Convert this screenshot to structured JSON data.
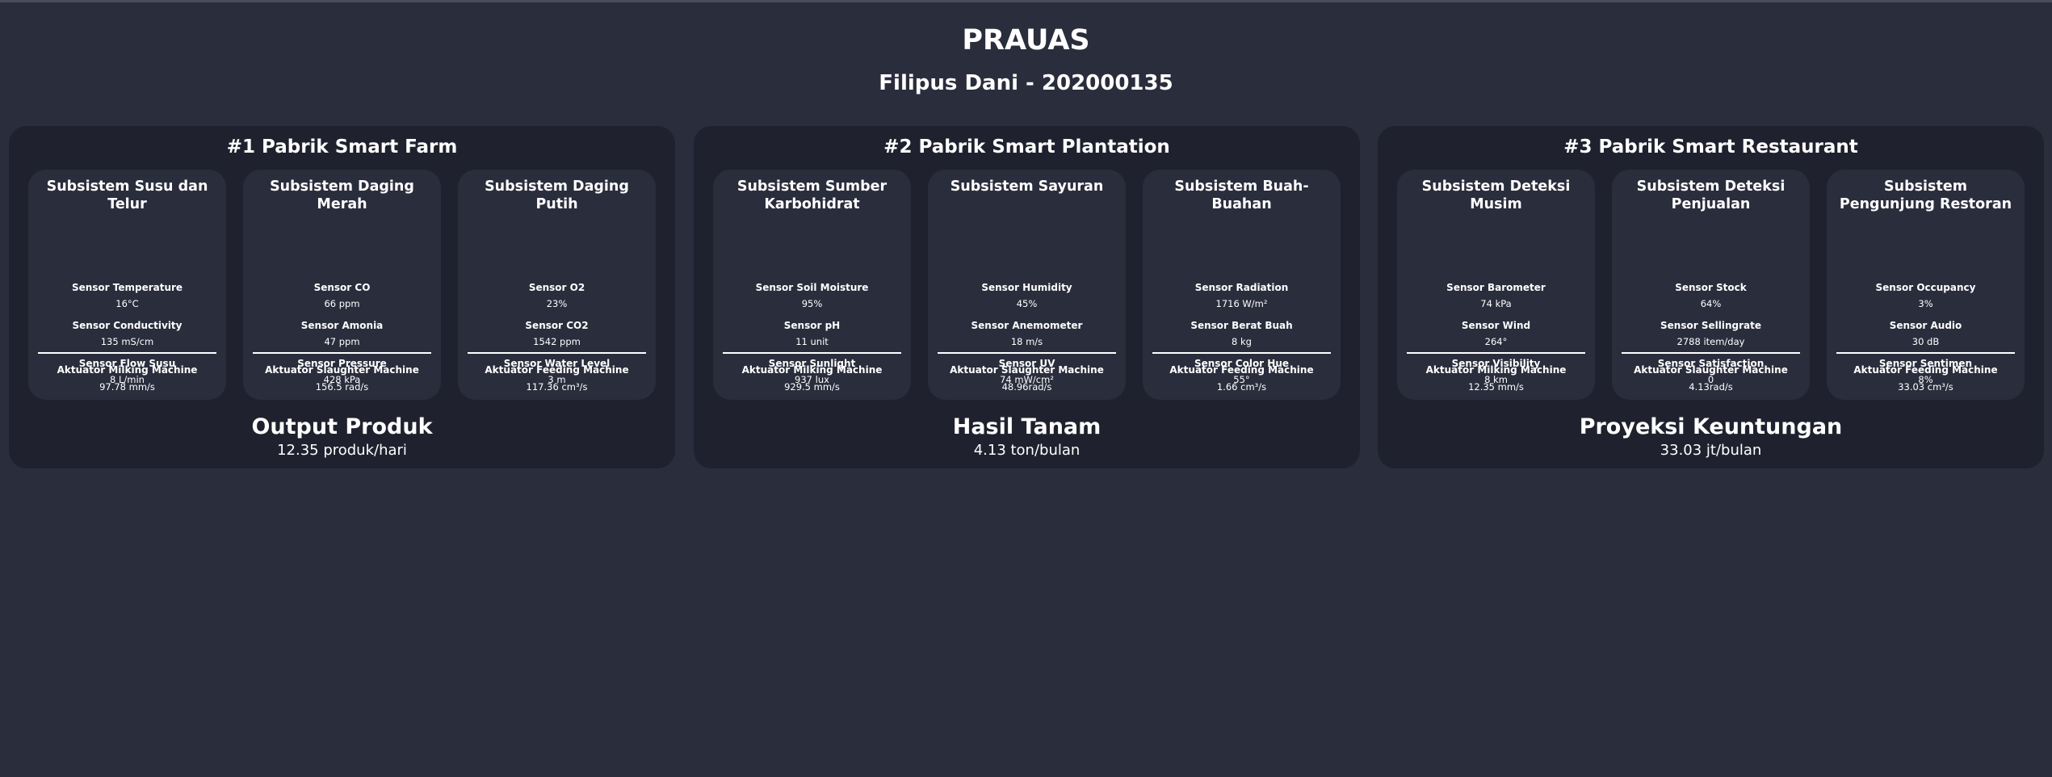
{
  "header": {
    "title": "PRAUAS",
    "subtitle": "Filipus Dani - 202000135"
  },
  "factories": [
    {
      "title": "#1 Pabrik Smart Farm",
      "output_title": "Output Produk",
      "output_value": "12.35 produk/hari",
      "subsystems": [
        {
          "title": "Subsistem Susu dan Telur",
          "sensors": [
            {
              "name": "Sensor Temperature",
              "value": "16°C"
            },
            {
              "name": "Sensor Conductivity",
              "value": "135 mS/cm"
            },
            {
              "name": "Sensor Flow Susu",
              "value": "8 L/min"
            }
          ],
          "actuator": {
            "name": "Aktuator Milking Machine",
            "value": "97.78 mm/s"
          }
        },
        {
          "title": "Subsistem Daging Merah",
          "sensors": [
            {
              "name": "Sensor CO",
              "value": "66 ppm"
            },
            {
              "name": "Sensor Amonia",
              "value": "47 ppm"
            },
            {
              "name": "Sensor Pressure",
              "value": "428 kPa"
            }
          ],
          "actuator": {
            "name": "Aktuator Slaughter Machine",
            "value": "156.5 rad/s"
          }
        },
        {
          "title": "Subsistem Daging Putih",
          "sensors": [
            {
              "name": "Sensor O2",
              "value": "23%"
            },
            {
              "name": "Sensor CO2",
              "value": "1542 ppm"
            },
            {
              "name": "Sensor Water Level",
              "value": "3 m"
            }
          ],
          "actuator": {
            "name": "Aktuator Feeding Machine",
            "value": "117.36 cm³/s"
          }
        }
      ]
    },
    {
      "title": "#2 Pabrik Smart Plantation",
      "output_title": "Hasil Tanam",
      "output_value": "4.13 ton/bulan",
      "subsystems": [
        {
          "title": "Subsistem Sumber Karbohidrat",
          "sensors": [
            {
              "name": "Sensor Soil Moisture",
              "value": "95%"
            },
            {
              "name": "Sensor pH",
              "value": "11 unit"
            },
            {
              "name": "Sensor Sunlight",
              "value": "937 lux"
            }
          ],
          "actuator": {
            "name": "Aktuator Milking Machine",
            "value": "929.5 mm/s"
          }
        },
        {
          "title": "Subsistem Sayuran",
          "sensors": [
            {
              "name": "Sensor Humidity",
              "value": "45%"
            },
            {
              "name": "Sensor Anemometer",
              "value": "18 m/s"
            },
            {
              "name": "Sensor UV",
              "value": "74 mW/cm²"
            }
          ],
          "actuator": {
            "name": "Aktuator Slaughter Machine",
            "value": "48.96rad/s"
          }
        },
        {
          "title": "Subsistem Buah-Buahan",
          "sensors": [
            {
              "name": "Sensor Radiation",
              "value": "1716 W/m²"
            },
            {
              "name": "Sensor Berat Buah",
              "value": "8 kg"
            },
            {
              "name": "Sensor Color Hue",
              "value": "55°"
            }
          ],
          "actuator": {
            "name": "Aktuator Feeding Machine",
            "value": "1.66 cm³/s"
          }
        }
      ]
    },
    {
      "title": "#3 Pabrik Smart Restaurant",
      "output_title": "Proyeksi Keuntungan",
      "output_value": "33.03 jt/bulan",
      "subsystems": [
        {
          "title": "Subsistem Deteksi Musim",
          "sensors": [
            {
              "name": "Sensor Barometer",
              "value": "74 kPa"
            },
            {
              "name": "Sensor Wind",
              "value": "264°"
            },
            {
              "name": "Sensor Visibility",
              "value": "8 km"
            }
          ],
          "actuator": {
            "name": "Aktuator Milking Machine",
            "value": "12.35 mm/s"
          }
        },
        {
          "title": "Subsistem Deteksi Penjualan",
          "sensors": [
            {
              "name": "Sensor Stock",
              "value": "64%"
            },
            {
              "name": "Sensor Sellingrate",
              "value": "2788 item/day"
            },
            {
              "name": "Sensor Satisfaction",
              "value": "0"
            }
          ],
          "actuator": {
            "name": "Aktuator Slaughter Machine",
            "value": "4.13rad/s"
          }
        },
        {
          "title": "Subsistem Pengunjung Restoran",
          "sensors": [
            {
              "name": "Sensor Occupancy",
              "value": "3%"
            },
            {
              "name": "Sensor Audio",
              "value": "30 dB"
            },
            {
              "name": "Sensor Sentimen",
              "value": "8%"
            }
          ],
          "actuator": {
            "name": "Aktuator Feeding Machine",
            "value": "33.03 cm³/s"
          }
        }
      ]
    }
  ]
}
